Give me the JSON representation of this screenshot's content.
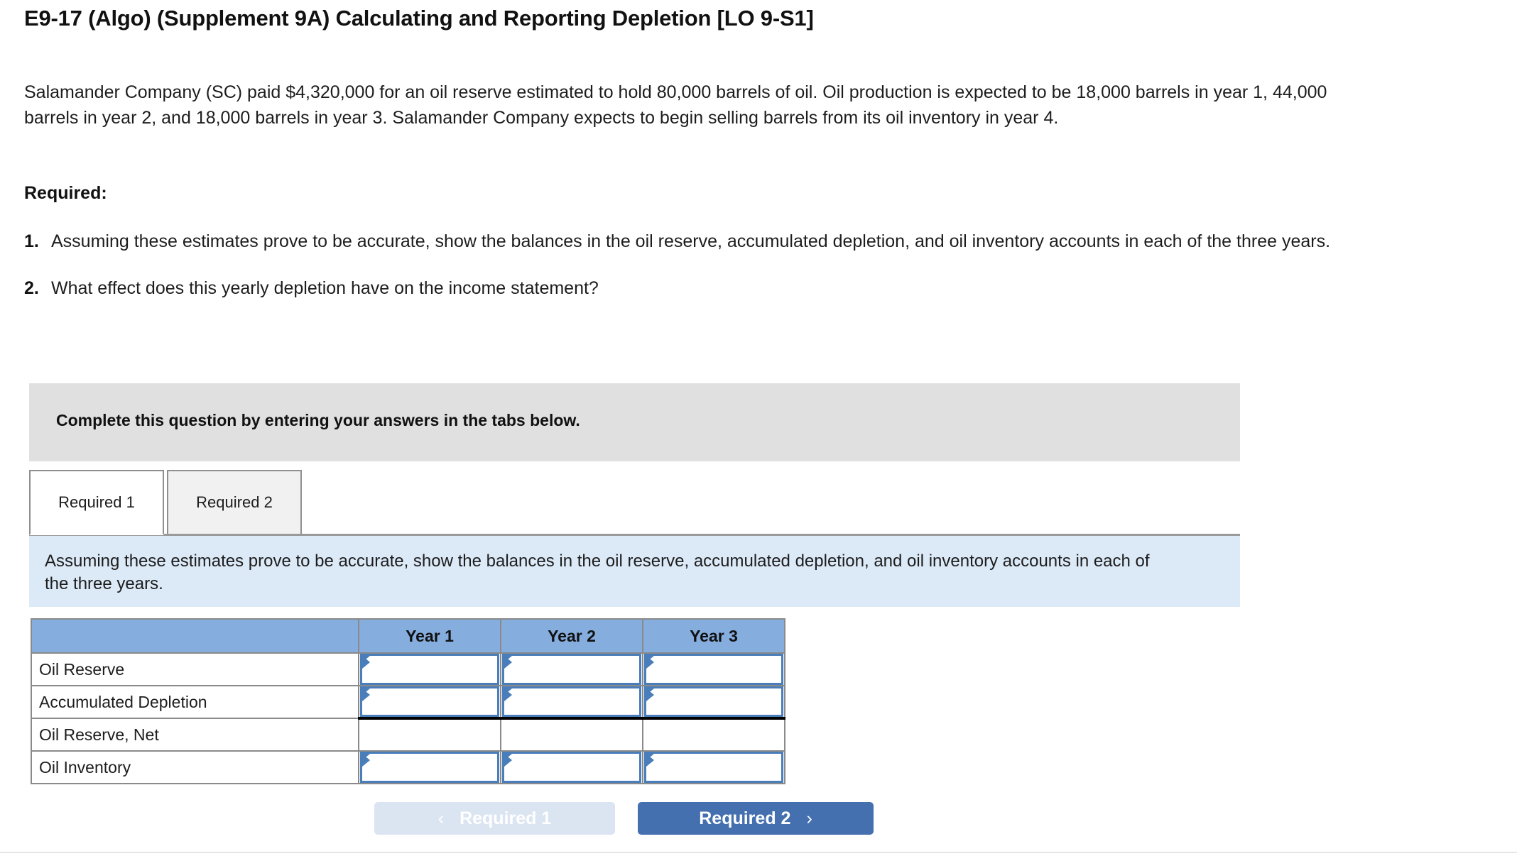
{
  "page_title": "E9-17 (Algo) (Supplement 9A) Calculating and Reporting Depletion [LO 9-S1]",
  "problem": {
    "body": "Salamander Company (SC) paid $4,320,000 for an oil reserve estimated to hold 80,000 barrels of oil. Oil production is expected to be 18,000 barrels in year 1, 44,000 barrels in year 2, and 18,000 barrels in year 3. Salamander Company expects to begin selling barrels from its oil inventory in year 4.",
    "required_label": "Required:",
    "requirements": [
      {
        "num": "1.",
        "text": "Assuming these estimates prove to be accurate, show the balances in the oil reserve, accumulated depletion, and oil inventory accounts in each of the three years."
      },
      {
        "num": "2.",
        "text": "What effect does this yearly depletion have on the income statement?"
      }
    ]
  },
  "instruction_bar": {
    "text": "Complete this question by entering your answers in the tabs below."
  },
  "tabs": [
    {
      "label": "Required 1",
      "active": true
    },
    {
      "label": "Required 2",
      "active": false
    }
  ],
  "blue_note": {
    "text": "Assuming these estimates prove to be accurate, show the balances in the oil reserve, accumulated depletion, and oil inventory accounts in each of the three years."
  },
  "answer_table": {
    "columns": [
      "",
      "Year 1",
      "Year 2",
      "Year 3"
    ],
    "rows": [
      {
        "label": "Oil Reserve",
        "inputs": [
          true,
          true,
          true
        ],
        "values": [
          "",
          "",
          ""
        ],
        "subtotal": false
      },
      {
        "label": "Accumulated Depletion",
        "inputs": [
          true,
          true,
          true
        ],
        "values": [
          "",
          "",
          ""
        ],
        "subtotal": true
      },
      {
        "label": "Oil Reserve, Net",
        "inputs": [
          false,
          false,
          false
        ],
        "values": [
          "",
          "",
          ""
        ],
        "subtotal": false
      },
      {
        "label": "Oil Inventory",
        "inputs": [
          true,
          true,
          true
        ],
        "values": [
          "",
          "",
          ""
        ],
        "subtotal": false
      }
    ]
  },
  "footer": {
    "prev_label": "Required 1",
    "next_label": "Required 2",
    "prev_chevron": "‹",
    "next_chevron": "›"
  },
  "colors": {
    "table_header_blue": "#85aede",
    "input_border_blue": "#4a7ebb",
    "note_blue": "#dce9f7",
    "banner_gray": "#e0e0e0",
    "next_button_blue": "#4470b0",
    "prev_button_blue": "#dbe5f2"
  }
}
